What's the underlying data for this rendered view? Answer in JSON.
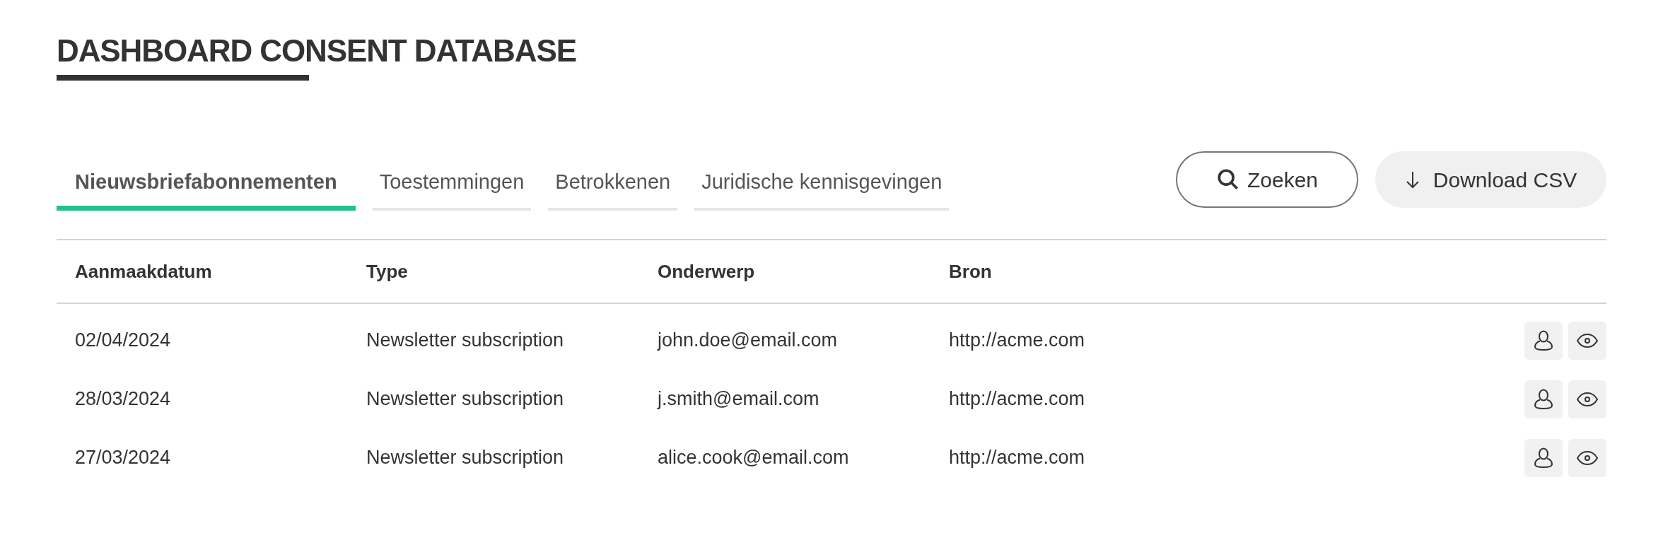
{
  "title": "DASHBOARD CONSENT DATABASE",
  "tabs": [
    {
      "label": "Nieuwsbriefabonnementen",
      "selected": true
    },
    {
      "label": "Toestemmingen",
      "selected": false
    },
    {
      "label": "Betrokkenen",
      "selected": false
    },
    {
      "label": "Juridische kennisgevingen",
      "selected": false
    }
  ],
  "buttons": {
    "search": "Zoeken",
    "download": "Download CSV"
  },
  "table": {
    "columns": [
      "Aanmaakdatum",
      "Type",
      "Onderwerp",
      "Bron"
    ],
    "rows": [
      [
        "02/04/2024",
        "Newsletter subscription",
        "john.doe@email.com",
        "http://acme.com"
      ],
      [
        "28/03/2024",
        "Newsletter subscription",
        "j.smith@email.com",
        "http://acme.com"
      ],
      [
        "27/03/2024",
        "Newsletter subscription",
        "alice.cook@email.com",
        "http://acme.com"
      ]
    ]
  }
}
